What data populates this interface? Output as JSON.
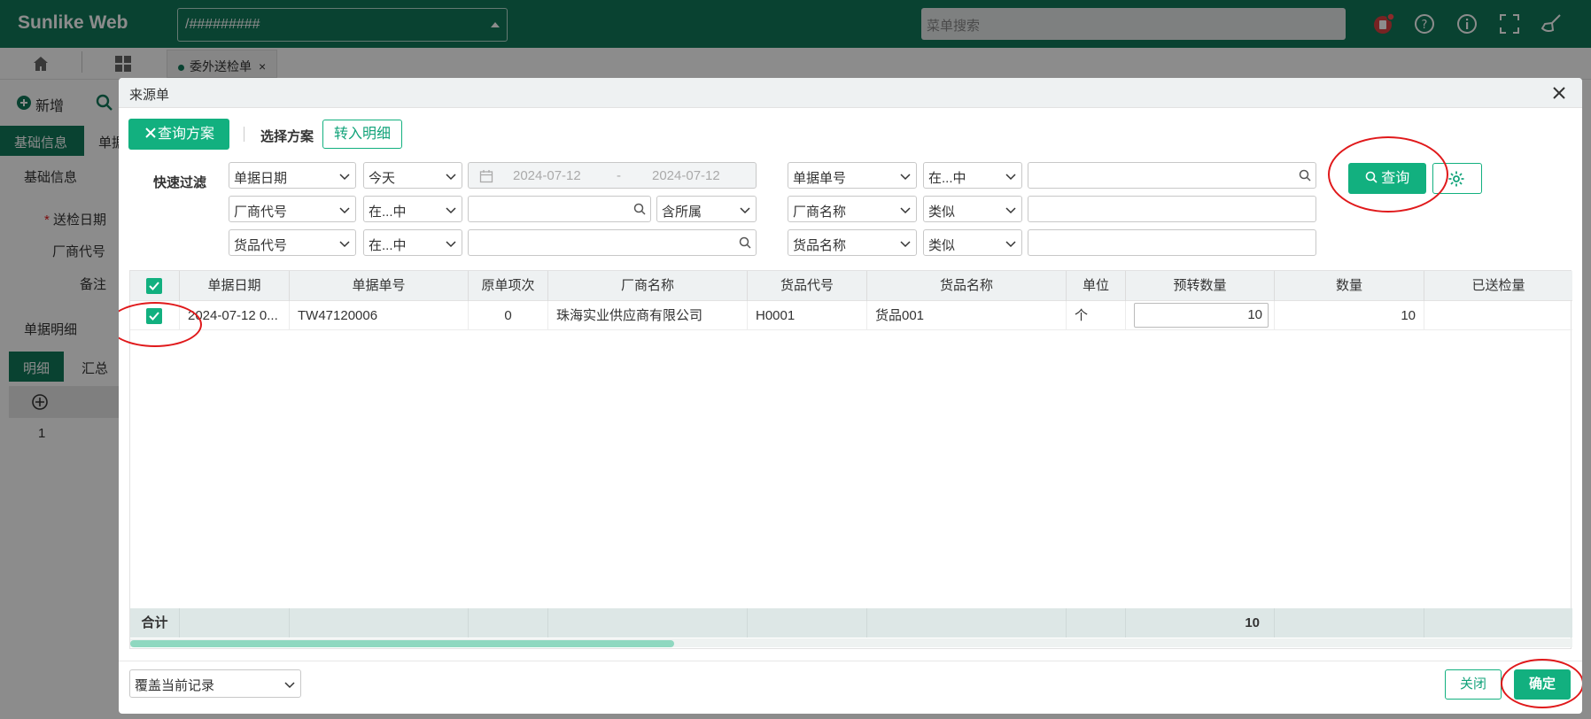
{
  "app": {
    "logo": "Sunlike Web",
    "path_value": "/#########",
    "menu_search_placeholder": "菜单搜索"
  },
  "tabs": {
    "active_doc": "委外送检单"
  },
  "background_page": {
    "toolbar": {
      "add_label": "新增"
    },
    "section_tabs": [
      "基础信息",
      "单据"
    ],
    "section_title": "基础信息",
    "fields": [
      {
        "label": "送检日期",
        "required": true
      },
      {
        "label": "厂商代号"
      },
      {
        "label": "备注"
      }
    ],
    "detail_title": "单据明细",
    "detail_tabs": [
      "明细",
      "汇总"
    ],
    "row_number": "1"
  },
  "modal": {
    "title": "来源单",
    "query_plan_button": "查询方案",
    "select_plan_label": "选择方案",
    "to_detail_button": "转入明细",
    "quick_filter_label": "快速过滤",
    "filters": {
      "row1": {
        "field": "单据日期",
        "range": "今天",
        "date_from": "2024-07-12",
        "date_sep": "-",
        "date_to": "2024-07-12",
        "field2": "单据单号",
        "op2": "在...中",
        "val2": ""
      },
      "row2": {
        "field": "厂商代号",
        "op": "在...中",
        "val": "",
        "scope": "含所属",
        "field2": "厂商名称",
        "op2": "类似",
        "val2": ""
      },
      "row3": {
        "field": "货品代号",
        "op": "在...中",
        "val": "",
        "field2": "货品名称",
        "op2": "类似",
        "val2": ""
      }
    },
    "query_button": "查询",
    "grid": {
      "columns": [
        "单据日期",
        "单据单号",
        "原单项次",
        "厂商名称",
        "货品代号",
        "货品名称",
        "单位",
        "预转数量",
        "数量",
        "已送检量"
      ],
      "rows": [
        {
          "checked": true,
          "date": "2024-07-12 0...",
          "doc_no": "TW47120006",
          "item_seq": "0",
          "vendor": "珠海实业供应商有限公司",
          "goods_code": "H0001",
          "goods_name": "货品001",
          "unit": "个",
          "pre_qty": "10",
          "qty": "10",
          "inspected_qty": ""
        }
      ],
      "footer_label": "合计",
      "footer_pre_qty": "10"
    },
    "mode_select": "覆盖当前记录",
    "close_button": "关闭",
    "confirm_button": "确定"
  },
  "colors": {
    "brand": "#12785a",
    "primary": "#12b07f",
    "annotation": "#e0191b"
  }
}
